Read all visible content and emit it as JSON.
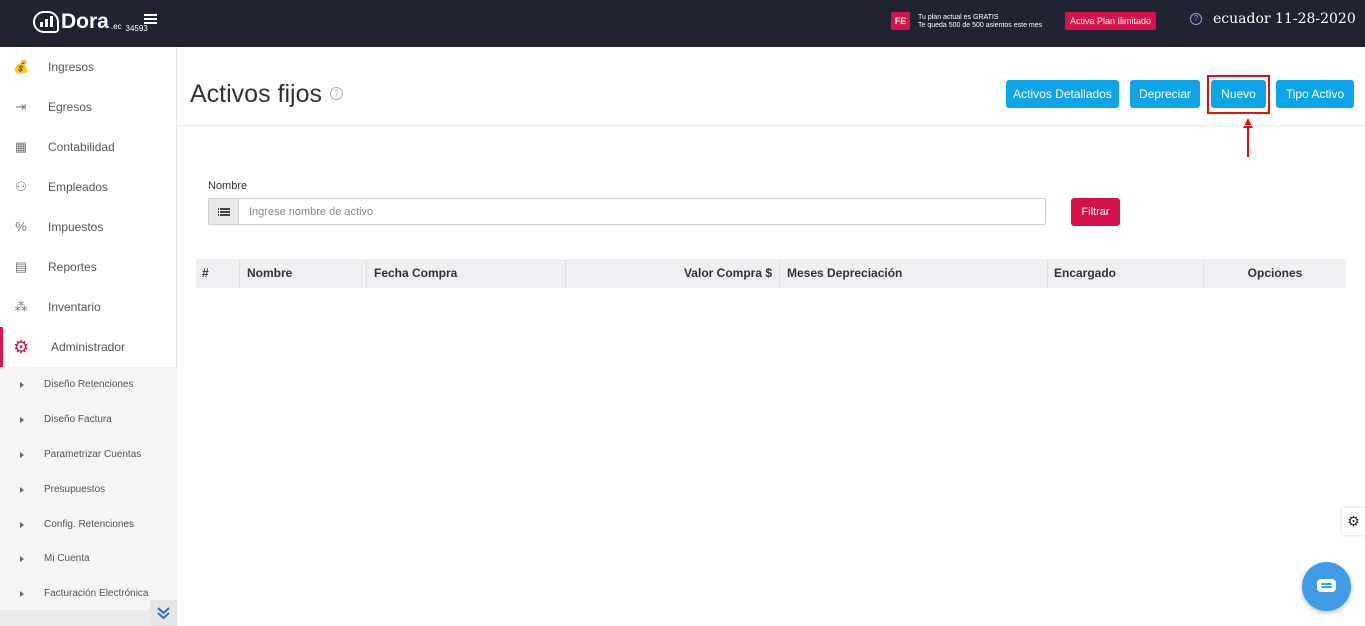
{
  "header": {
    "logo_name": "Dora",
    "logo_suffix": ".ec",
    "account_number": "34593",
    "fe_badge": "FE",
    "plan_line1": "Tu plan actual es GRATIS",
    "plan_line2": "Te queda 500 de 500 asientos este mes",
    "plan_button": "Activa Plan Ilimitado",
    "help_icon_char": "?",
    "user_date": "ecuador 11-28-2020"
  },
  "sidebar": {
    "items": [
      {
        "label": "Ingresos",
        "icon": "money-bag-icon",
        "glyph": "💰"
      },
      {
        "label": "Egresos",
        "icon": "transfer-out-icon",
        "glyph": "⇥"
      },
      {
        "label": "Contabilidad",
        "icon": "calculator-icon",
        "glyph": "▦"
      },
      {
        "label": "Empleados",
        "icon": "org-chart-icon",
        "glyph": "⚇"
      },
      {
        "label": "Impuestos",
        "icon": "tax-icon",
        "glyph": "%"
      },
      {
        "label": "Reportes",
        "icon": "report-icon",
        "glyph": "▤"
      },
      {
        "label": "Inventario",
        "icon": "boxes-icon",
        "glyph": "⁂"
      },
      {
        "label": "Administrador",
        "icon": "gear-icon",
        "glyph": "⚙"
      }
    ],
    "sub_items": [
      {
        "label": "Diseño Retenciones"
      },
      {
        "label": "Diseño Factura"
      },
      {
        "label": "Parametrizar Cuentas"
      },
      {
        "label": "Presupuestos"
      },
      {
        "label": "Config. Retenciones"
      },
      {
        "label": "Mi Cuenta"
      },
      {
        "label": "Facturación Electrónica"
      }
    ]
  },
  "main": {
    "title": "Activos fijos",
    "buttons": {
      "detallados": "Activos Detallados",
      "depreciar": "Depreciar",
      "nuevo": "Nuevo",
      "tipo_activo": "Tipo Activo"
    },
    "filter": {
      "label": "Nombre",
      "placeholder": "Ingrese nombre de activo",
      "value": "",
      "button": "Filtrar"
    },
    "table": {
      "columns": [
        "#",
        "Nombre",
        "Fecha Compra",
        "Valor Compra $",
        "Meses Depreciación",
        "Encargado",
        "Opciones"
      ],
      "rows": []
    }
  },
  "colors": {
    "topbar": "#1f2332",
    "accent_red": "#d6124a",
    "button_blue": "#0ca5ea",
    "annotation_red": "#e01010",
    "chat_blue": "#3f9be6"
  }
}
